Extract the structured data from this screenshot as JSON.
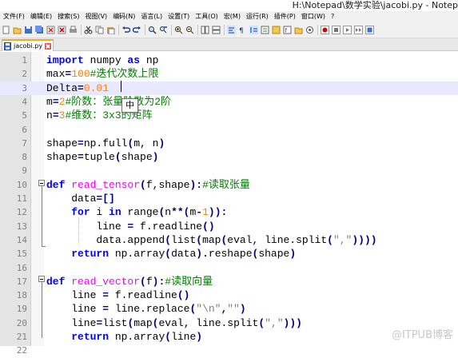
{
  "window": {
    "title": "H:\\Notepad\\数学实验\\jacobi.py - Notep"
  },
  "menu": [
    "文件(F)",
    "编辑(E)",
    "搜索(S)",
    "视图(V)",
    "编码(N)",
    "语言(L)",
    "设置(T)",
    "工具(O)",
    "宏(M)",
    "运行(R)",
    "插件(P)",
    "窗口(W)",
    "?"
  ],
  "toolbar": [
    "new-icon",
    "open-icon",
    "save-icon",
    "save-all-icon",
    "close-icon",
    "close-all-icon",
    "print-icon",
    "|",
    "cut-icon",
    "copy-icon",
    "paste-icon",
    "|",
    "undo-icon",
    "redo-icon",
    "|",
    "find-icon",
    "replace-icon",
    "|",
    "zoom-in-icon",
    "zoom-out-icon",
    "|",
    "sync-v-icon",
    "sync-h-icon",
    "|",
    "wrap-icon",
    "all-chars-icon",
    "indent-guide-icon",
    "udl-icon",
    "doc-map-icon",
    "function-list-icon",
    "folder-icon",
    "monitor-icon",
    "|",
    "record-icon",
    "stop-icon",
    "play-icon",
    "run-multi-icon",
    "save-macro-icon"
  ],
  "tab": {
    "label": "jacobi.py",
    "icon": "saved-file-icon"
  },
  "editor": {
    "lines": [
      {
        "num": "1",
        "tokens": [
          {
            "t": "import",
            "c": "k"
          },
          {
            "t": " numpy ",
            "c": "d"
          },
          {
            "t": "as",
            "c": "k"
          },
          {
            "t": " np",
            "c": "d"
          }
        ]
      },
      {
        "num": "2",
        "tokens": [
          {
            "t": "max",
            "c": "d"
          },
          {
            "t": "=",
            "c": "o"
          },
          {
            "t": "100",
            "c": "n"
          },
          {
            "t": "#迭代次数上限",
            "c": "c"
          }
        ]
      },
      {
        "num": "3",
        "tokens": [
          {
            "t": "Delta",
            "c": "d"
          },
          {
            "t": "=",
            "c": "o"
          },
          {
            "t": "0.01",
            "c": "n"
          }
        ]
      },
      {
        "num": "4",
        "tokens": [
          {
            "t": "m",
            "c": "d"
          },
          {
            "t": "=",
            "c": "o"
          },
          {
            "t": "2",
            "c": "n"
          },
          {
            "t": "#阶数：张量阶数为2阶",
            "c": "c"
          }
        ]
      },
      {
        "num": "5",
        "tokens": [
          {
            "t": "n",
            "c": "d"
          },
          {
            "t": "=",
            "c": "o"
          },
          {
            "t": "3",
            "c": "n"
          },
          {
            "t": "#维数：3x3的矩阵",
            "c": "c"
          }
        ]
      },
      {
        "num": "6",
        "tokens": []
      },
      {
        "num": "7",
        "tokens": [
          {
            "t": "shape",
            "c": "d"
          },
          {
            "t": "=",
            "c": "o"
          },
          {
            "t": "np.full",
            "c": "d"
          },
          {
            "t": "(",
            "c": "o"
          },
          {
            "t": "m, n",
            "c": "d"
          },
          {
            "t": ")",
            "c": "o"
          }
        ]
      },
      {
        "num": "8",
        "tokens": [
          {
            "t": "shape",
            "c": "d"
          },
          {
            "t": "=",
            "c": "o"
          },
          {
            "t": "tuple",
            "c": "d"
          },
          {
            "t": "(",
            "c": "o"
          },
          {
            "t": "shape",
            "c": "d"
          },
          {
            "t": ")",
            "c": "o"
          }
        ]
      },
      {
        "num": "9",
        "tokens": []
      },
      {
        "num": "10",
        "tokens": [
          {
            "t": "def",
            "c": "k"
          },
          {
            "t": " ",
            "c": "d"
          },
          {
            "t": "read_tensor",
            "c": "f"
          },
          {
            "t": "(",
            "c": "o"
          },
          {
            "t": "f,shape",
            "c": "d"
          },
          {
            "t": "):",
            "c": "o"
          },
          {
            "t": "#读取张量",
            "c": "c"
          }
        ]
      },
      {
        "num": "11",
        "tokens": [
          {
            "t": "    data",
            "c": "d"
          },
          {
            "t": "=[]",
            "c": "o"
          }
        ]
      },
      {
        "num": "12",
        "tokens": [
          {
            "t": "    ",
            "c": "d"
          },
          {
            "t": "for",
            "c": "k"
          },
          {
            "t": " i ",
            "c": "d"
          },
          {
            "t": "in",
            "c": "k"
          },
          {
            "t": " range",
            "c": "d"
          },
          {
            "t": "(",
            "c": "o"
          },
          {
            "t": "n",
            "c": "d"
          },
          {
            "t": "**(",
            "c": "o"
          },
          {
            "t": "m",
            "c": "d"
          },
          {
            "t": "-",
            "c": "o"
          },
          {
            "t": "1",
            "c": "n"
          },
          {
            "t": ")):",
            "c": "o"
          }
        ]
      },
      {
        "num": "13",
        "tokens": [
          {
            "t": "        line ",
            "c": "d"
          },
          {
            "t": "=",
            "c": "o"
          },
          {
            "t": " f.readline",
            "c": "d"
          },
          {
            "t": "()",
            "c": "o"
          }
        ]
      },
      {
        "num": "14",
        "tokens": [
          {
            "t": "        data.append",
            "c": "d"
          },
          {
            "t": "(",
            "c": "o"
          },
          {
            "t": "list",
            "c": "d"
          },
          {
            "t": "(",
            "c": "o"
          },
          {
            "t": "map",
            "c": "d"
          },
          {
            "t": "(",
            "c": "o"
          },
          {
            "t": "eval, line.split",
            "c": "d"
          },
          {
            "t": "(",
            "c": "o"
          },
          {
            "t": "\",\"",
            "c": "s"
          },
          {
            "t": "))))",
            "c": "o"
          }
        ]
      },
      {
        "num": "15",
        "tokens": [
          {
            "t": "    ",
            "c": "d"
          },
          {
            "t": "return",
            "c": "k"
          },
          {
            "t": " np.array",
            "c": "d"
          },
          {
            "t": "(",
            "c": "o"
          },
          {
            "t": "data",
            "c": "d"
          },
          {
            "t": ").",
            "c": "o"
          },
          {
            "t": "reshape",
            "c": "d"
          },
          {
            "t": "(",
            "c": "o"
          },
          {
            "t": "shape",
            "c": "d"
          },
          {
            "t": ")",
            "c": "o"
          }
        ]
      },
      {
        "num": "16",
        "tokens": []
      },
      {
        "num": "17",
        "tokens": [
          {
            "t": "def",
            "c": "k"
          },
          {
            "t": " ",
            "c": "d"
          },
          {
            "t": "read_vector",
            "c": "f"
          },
          {
            "t": "(",
            "c": "o"
          },
          {
            "t": "f",
            "c": "d"
          },
          {
            "t": "):",
            "c": "o"
          },
          {
            "t": "#读取向量",
            "c": "c"
          }
        ]
      },
      {
        "num": "18",
        "tokens": [
          {
            "t": "    line ",
            "c": "d"
          },
          {
            "t": "=",
            "c": "o"
          },
          {
            "t": " f.readline",
            "c": "d"
          },
          {
            "t": "()",
            "c": "o"
          }
        ]
      },
      {
        "num": "19",
        "tokens": [
          {
            "t": "    line ",
            "c": "d"
          },
          {
            "t": "=",
            "c": "o"
          },
          {
            "t": " line.replace",
            "c": "d"
          },
          {
            "t": "(",
            "c": "o"
          },
          {
            "t": "\"\\n\"",
            "c": "s"
          },
          {
            "t": ",",
            "c": "o"
          },
          {
            "t": "\"\"",
            "c": "s"
          },
          {
            "t": ")",
            "c": "o"
          }
        ]
      },
      {
        "num": "20",
        "tokens": [
          {
            "t": "    line",
            "c": "d"
          },
          {
            "t": "=",
            "c": "o"
          },
          {
            "t": "list",
            "c": "d"
          },
          {
            "t": "(",
            "c": "o"
          },
          {
            "t": "map",
            "c": "d"
          },
          {
            "t": "(",
            "c": "o"
          },
          {
            "t": "eval, line.split",
            "c": "d"
          },
          {
            "t": "(",
            "c": "o"
          },
          {
            "t": "\",\"",
            "c": "s"
          },
          {
            "t": ")))",
            "c": "o"
          }
        ]
      },
      {
        "num": "21",
        "tokens": [
          {
            "t": "    ",
            "c": "d"
          },
          {
            "t": "return",
            "c": "k"
          },
          {
            "t": " np.array",
            "c": "d"
          },
          {
            "t": "(",
            "c": "o"
          },
          {
            "t": "line",
            "c": "d"
          },
          {
            "t": ")",
            "c": "o"
          }
        ]
      },
      {
        "num": "22",
        "tokens": []
      }
    ]
  },
  "ime": {
    "text": "中"
  },
  "watermark": "@ITPUB博客"
}
